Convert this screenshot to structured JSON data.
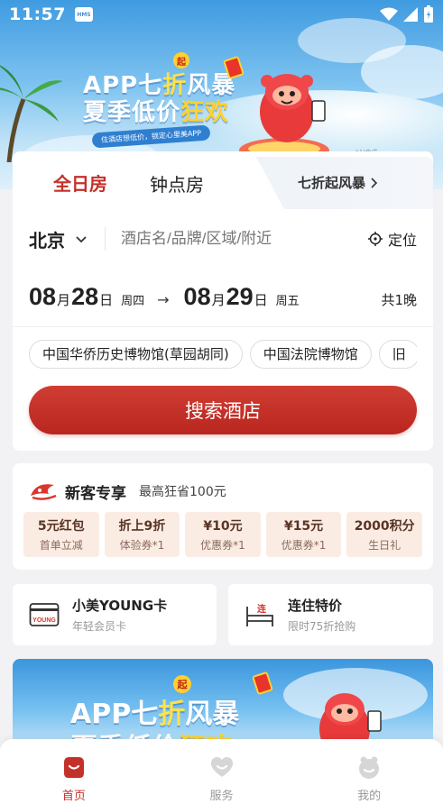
{
  "status_bar": {
    "time": "11:57",
    "badge": "HMS"
  },
  "banner": {
    "line1_a": "APP七",
    "line1_b": "折",
    "line1_c": "风暴",
    "line2_a": "夏季低价",
    "line2_b": "狂欢",
    "qi": "起",
    "subtitle": "住酒店想低价，锁定心里美APP",
    "note": "*AI合成"
  },
  "tabs": {
    "full_day": "全日房",
    "hourly": "钟点房",
    "promo": "七折起风暴"
  },
  "search": {
    "city": "北京",
    "placeholder": "酒店名/品牌/区域/附近",
    "locate": "定位"
  },
  "dates": {
    "checkin_month": "08",
    "checkin_day": "28",
    "checkin_week": "周四",
    "checkout_month": "08",
    "checkout_day": "29",
    "checkout_week": "周五",
    "unit_month": "月",
    "unit_day": "日",
    "nights": "共1晚"
  },
  "chips": [
    "中国华侨历史博物馆(草园胡同)",
    "中国法院博物馆",
    "旧"
  ],
  "search_button": "搜索酒店",
  "new_customer": {
    "title": "新客专享",
    "subtitle": "最高狂省100元",
    "coupons": [
      {
        "top": "5元红包",
        "bottom": "首单立减"
      },
      {
        "top": "折上9折",
        "bottom": "体验券*1"
      },
      {
        "top": "¥10元",
        "bottom": "优惠券*1"
      },
      {
        "top": "¥15元",
        "bottom": "优惠券*1"
      },
      {
        "top": "2000积分",
        "bottom": "生日礼"
      }
    ]
  },
  "cards": {
    "young": {
      "title": "小美YOUNG卡",
      "subtitle": "年轻会员卡",
      "icon_text": "YOUNG"
    },
    "stay": {
      "title": "连住特价",
      "subtitle": "限时75折抢购",
      "icon_text": "连"
    }
  },
  "bottom_nav": {
    "home": "首页",
    "service": "服务",
    "mine": "我的"
  },
  "colors": {
    "accent": "#c3312a",
    "coupon_bg": "#fbece3",
    "banner_blue": "#3f9be0"
  }
}
